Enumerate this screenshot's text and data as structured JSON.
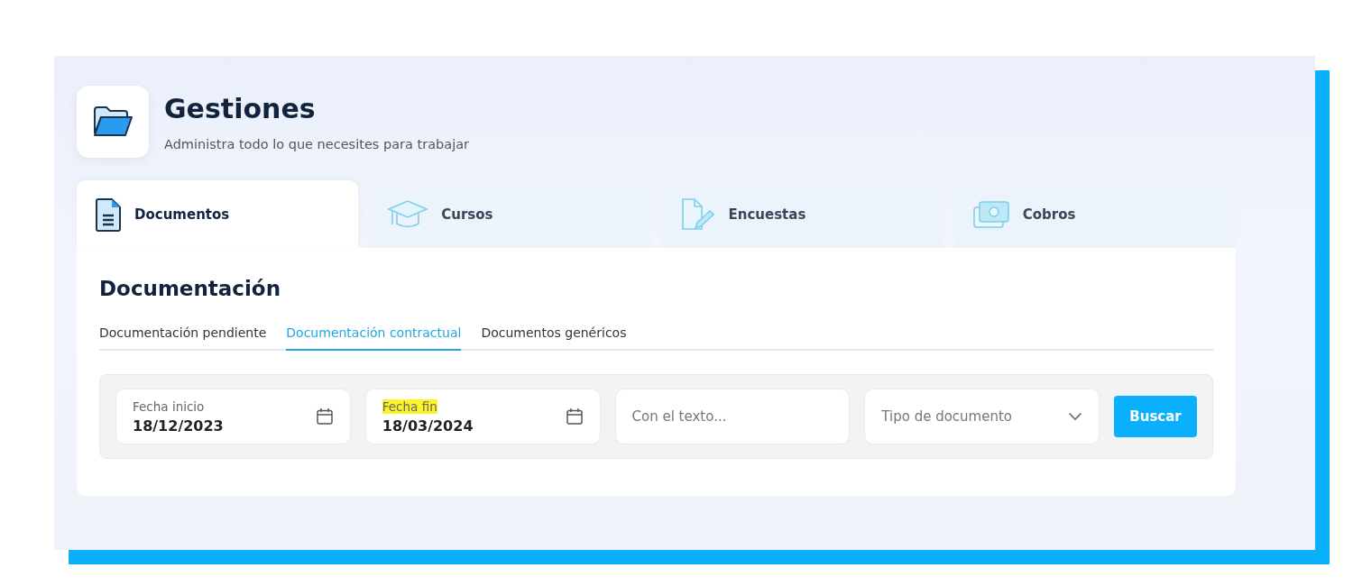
{
  "header": {
    "title": "Gestiones",
    "subtitle": "Administra todo lo que necesites para trabajar"
  },
  "tabs": [
    {
      "label": "Documentos",
      "kind": "document",
      "selected": true
    },
    {
      "label": "Cursos",
      "kind": "cap",
      "selected": false
    },
    {
      "label": "Encuestas",
      "kind": "edit",
      "selected": false
    },
    {
      "label": "Cobros",
      "kind": "money",
      "selected": false
    }
  ],
  "section_title": "Documentación",
  "subtabs": [
    {
      "label": "Documentación pendiente",
      "selected": false
    },
    {
      "label": "Documentación contractual",
      "selected": true
    },
    {
      "label": "Documentos genéricos",
      "selected": false
    }
  ],
  "filters": [
    {
      "kind": "date",
      "label": "Fecha inicio",
      "value": "18/12/2023",
      "highlighted": false
    },
    {
      "kind": "date",
      "label": "Fecha fin",
      "value": "18/03/2024",
      "highlighted": true
    },
    {
      "kind": "text",
      "placeholder": "Con el texto..."
    },
    {
      "kind": "select",
      "placeholder": "Tipo de documento"
    }
  ],
  "search_button": "Buscar"
}
